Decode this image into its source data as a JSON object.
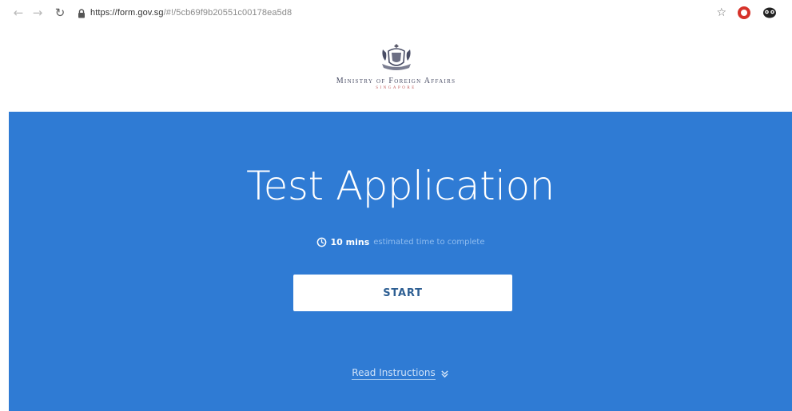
{
  "browser": {
    "url_host": "https://form.gov.sg",
    "url_path": "/#!/5cb69f9b20551c00178ea5d8"
  },
  "header": {
    "ministry_name": "Ministry of Foreign Affairs",
    "ministry_sub": "SINGAPORE"
  },
  "hero": {
    "title": "Test Application",
    "estimate_duration": "10 mins",
    "estimate_tail": "estimated time to complete",
    "start_label": "START",
    "instructions_label": "Read Instructions"
  },
  "icons": {
    "back": "back-arrow-icon",
    "forward": "forward-arrow-icon",
    "reload": "reload-icon",
    "lock": "lock-icon",
    "bookmark": "star-icon",
    "opera": "opera-icon",
    "extension": "extension-icon",
    "crest": "coat-of-arms-icon",
    "clock": "clock-icon",
    "chevron": "double-chevron-down-icon"
  },
  "colors": {
    "hero_blue": "#2f7bd4",
    "button_text": "#2e5f93",
    "opera_red": "#d6322a"
  }
}
